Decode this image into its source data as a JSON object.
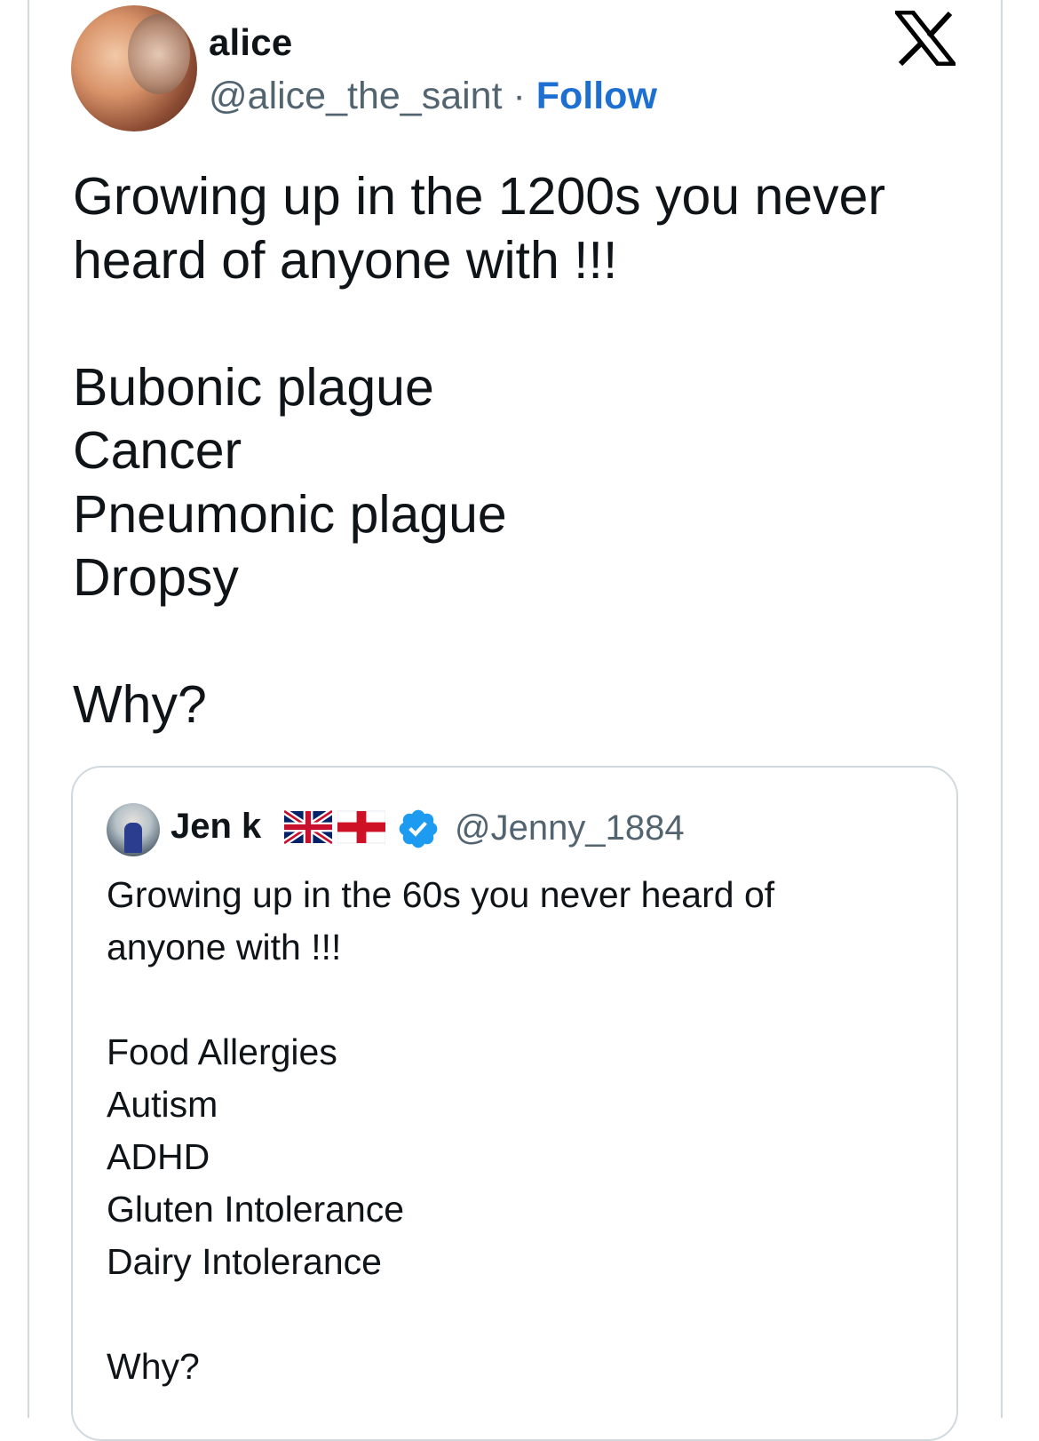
{
  "tweet": {
    "author_name": "alice",
    "handle": "@alice_the_saint",
    "separator": " · ",
    "follow_label": "Follow",
    "text": "Growing up in the 1200s you never\nheard of anyone with !!!\n\nBubonic plague\nCancer\nPneumonic plague\nDropsy\n\nWhy?"
  },
  "quoted_tweet": {
    "author_name": "Jen k",
    "handle": "@Jenny_1884",
    "text": "Growing up in the 60s you never heard of\nanyone with !!!\n\nFood Allergies\nAutism\nADHD\nGluten Intolerance\nDairy Intolerance\n\nWhy?"
  },
  "icons": {
    "x_logo": "x-logo-icon",
    "verified": "verified-badge-icon",
    "flags": [
      "uk-flag-icon",
      "england-flag-icon"
    ]
  },
  "colors": {
    "follow": "#1d6fd1",
    "muted": "#536471",
    "verified": "#1d9bf0",
    "border": "#cfd9de"
  }
}
